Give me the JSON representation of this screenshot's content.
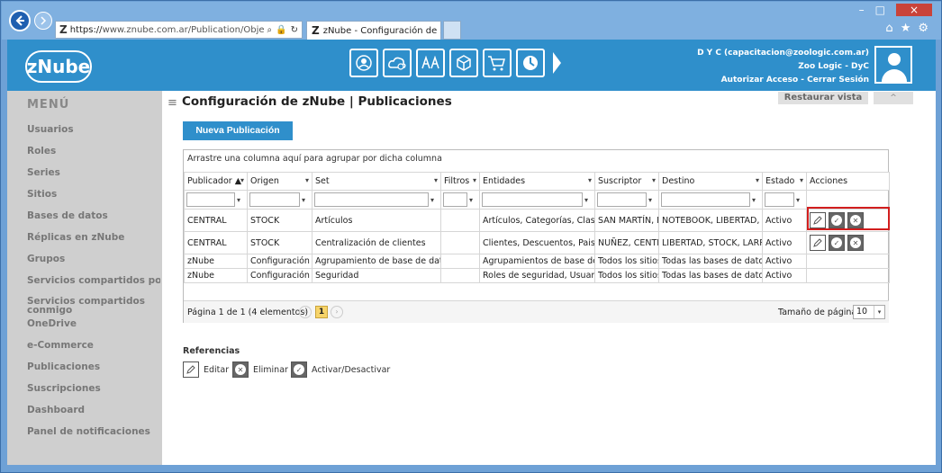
{
  "browser": {
    "url_prefix": "https://",
    "url_rest": "www.znube.com.ar/Publication/ObjectPubl",
    "tab_title": "zNube - Configuración de z...",
    "tab_close": "×",
    "window_controls": [
      "–",
      "□",
      "×"
    ],
    "logo_letter": "Z"
  },
  "header": {
    "logo": "zNube",
    "user_line1": "D Y C (capacitacion@zoologic.com.ar)",
    "user_line2": "Zoo Logic - DyC",
    "user_line3": "Autorizar Acceso - Cerrar Sesión",
    "modules": [
      "users-module-icon",
      "cloud-settings-module-icon",
      "font-module-icon",
      "cube-module-icon",
      "cart-module-icon",
      "clock-module-icon"
    ]
  },
  "sidebar": {
    "title": "MENÚ",
    "items": [
      "Usuarios",
      "Roles",
      "Series",
      "Sitios",
      "Bases de datos",
      "Réplicas en zNube",
      "Grupos",
      "Servicios compartidos por mi",
      "Servicios compartidos conmigo",
      "OneDrive",
      "e-Commerce",
      "Publicaciones",
      "Suscripciones",
      "Dashboard",
      "Panel de notificaciones"
    ]
  },
  "main": {
    "title": "Configuración de zNube | Publicaciones",
    "restore_label": "Restaurar vista",
    "collapse_label": "^",
    "new_button": "Nueva Publicación",
    "group_hint": "Arrastre una columna aquí para agrupar por dicha columna",
    "columns": [
      "Publicador",
      "Origen",
      "Set",
      "Filtros",
      "Entidades",
      "Suscriptor",
      "Destino",
      "Estado",
      "Acciones"
    ],
    "rows": [
      {
        "publicador": "CENTRAL",
        "origen": "STOCK",
        "set": "Artículos",
        "filtros": "",
        "entidades": "Artículos, Categorías, Clasificac",
        "suscriptor": "SAN MARTÍN, NI",
        "destino": "NOTEBOOK, LIBERTAD, GU",
        "estado": "Activo"
      },
      {
        "publicador": "CENTRAL",
        "origen": "STOCK",
        "set": "Centralización de clientes",
        "filtros": "",
        "entidades": "Clientes, Descuentos, Paises,",
        "suscriptor": "NUÑEZ, CENTRA",
        "destino": "LIBERTAD, STOCK, LARRA",
        "estado": "Activo"
      },
      {
        "publicador": "zNube",
        "origen": "Configuración",
        "set": "Agrupamiento de base de datos",
        "filtros": "",
        "entidades": "Agrupamientos de base de da",
        "suscriptor": "Todos los sitios",
        "destino": "Todas las bases de datos",
        "estado": "Activo"
      },
      {
        "publicador": "zNube",
        "origen": "Configuración",
        "set": "Seguridad",
        "filtros": "",
        "entidades": "Roles de seguridad, Usuarios",
        "suscriptor": "Todos los sitios",
        "destino": "Todas las bases de datos",
        "estado": "Activo"
      }
    ],
    "pager_text": "Página 1 de 1 (4 elementos)",
    "current_page": "1",
    "page_size_label": "Tamaño de página:",
    "page_size": "10"
  },
  "references": {
    "title": "Referencias",
    "edit": "Editar",
    "delete": "Eliminar",
    "toggle": "Activar/Desactivar"
  },
  "colors": {
    "accent": "#2f8fcb",
    "sidebar": "#cfcfcf",
    "highlight": "#d21e1e"
  }
}
